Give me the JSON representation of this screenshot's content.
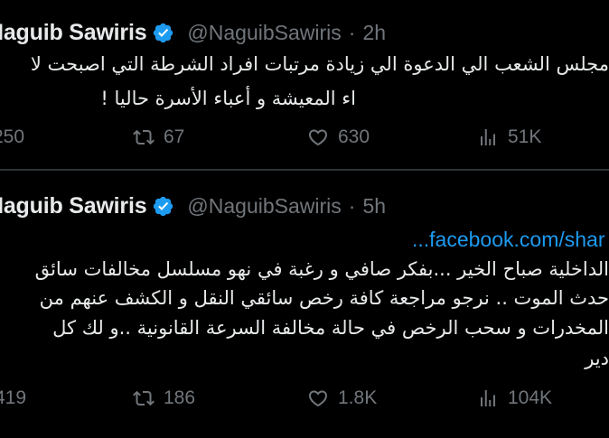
{
  "tweets": [
    {
      "author_name": "Naguib Sawiris",
      "author_handle": "@NaguibSawiris",
      "separator": "·",
      "time": "2h",
      "text_lines": [
        "مجلس الشعب الي الدعوة الي زيادة مرتبات افراد الشرطة التي اصبحت لا",
        "اء المعيشة و أعباء الأسرة حاليا !"
      ],
      "replies": "250",
      "retweets": "67",
      "likes": "630",
      "views": "51K"
    },
    {
      "author_name": "Naguib Sawiris",
      "author_handle": "@NaguibSawiris",
      "separator": "·",
      "time": "5h",
      "link": "...facebook.com/shar",
      "text_lines": [
        "الداخلية صباح الخير ...بفكر صافي و رغبة في نهو مسلسل مخالفات سائق",
        "حدث الموت .. نرجو مراجعة كافة رخص سائقي النقل و الكشف عنهم من",
        "المخدرات و سحب الرخص في حالة مخالفة السرعة القانونية  ..و لك كل",
        "دير"
      ],
      "replies": "419",
      "retweets": "186",
      "likes": "1.8K",
      "views": "104K"
    }
  ],
  "icons": {
    "verified": "verified-badge-icon",
    "reply": "reply-icon",
    "retweet": "retweet-icon",
    "like": "heart-icon",
    "views": "views-icon"
  },
  "colors": {
    "background": "#000000",
    "text": "#e7e9ea",
    "muted": "#71767b",
    "link": "#1d9bf0",
    "verified": "#1d9bf0",
    "divider": "#2f3336"
  }
}
